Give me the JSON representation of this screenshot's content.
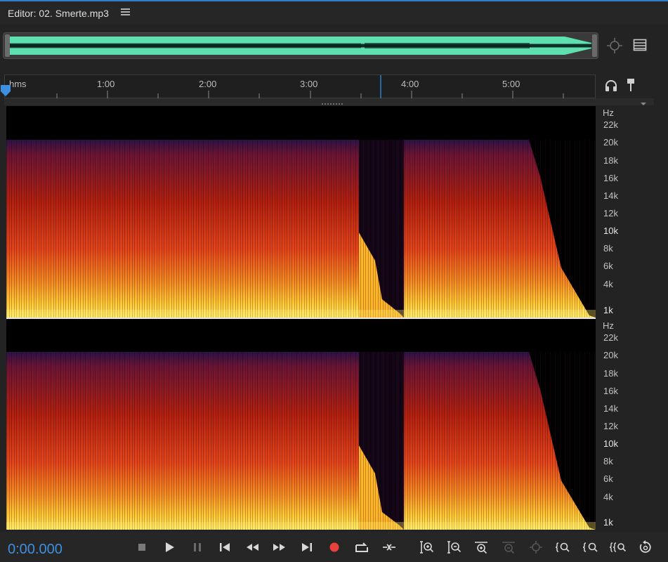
{
  "header": {
    "title": "Editor: 02. Smerte.mp3",
    "menu_icon": "hamburger-menu-icon"
  },
  "overview": {
    "waveform_color": "#5fe0b0"
  },
  "ruler": {
    "unit": "hms",
    "labels": [
      "1:00",
      "2:00",
      "3:00",
      "4:00",
      "5:00"
    ]
  },
  "channels": [
    {
      "axis_unit": "Hz",
      "freq_labels": [
        "22k",
        "20k",
        "18k",
        "16k",
        "14k",
        "12k",
        "10k",
        "8k",
        "6k",
        "4k",
        "1k"
      ]
    },
    {
      "axis_unit": "Hz",
      "freq_labels": [
        "22k",
        "20k",
        "18k",
        "16k",
        "14k",
        "12k",
        "10k",
        "8k",
        "6k",
        "4k",
        "1k"
      ]
    }
  ],
  "transport": {
    "timecode": "0:00.000",
    "timecode_color": "#3d8fe0",
    "record_color": "#e8413b"
  },
  "colors": {
    "accent": "#2f7fd1",
    "spectral_hot": "#ffd23a",
    "spectral_mid": "#d8331a",
    "spectral_low": "#3a1a55"
  }
}
